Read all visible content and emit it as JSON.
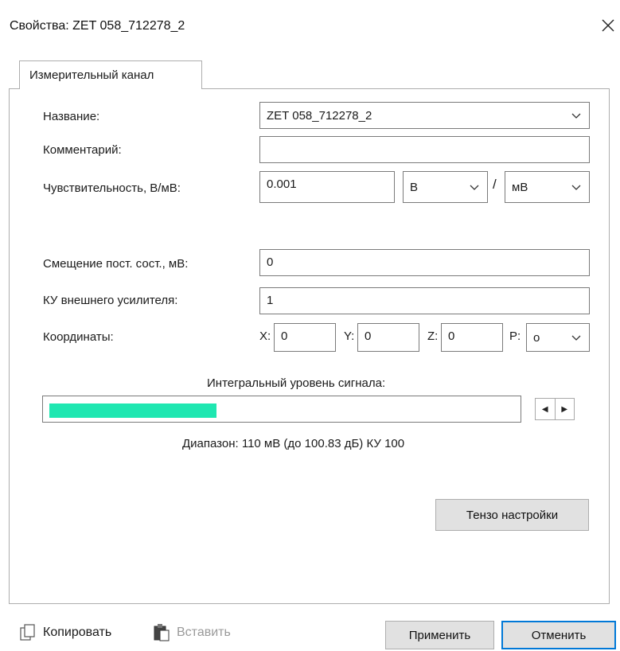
{
  "window": {
    "title": "Свойства: ZET 058_712278_2",
    "close_icon": "close-icon"
  },
  "tabs": [
    {
      "label": "Измерительный канал",
      "active": true
    }
  ],
  "form": {
    "name": {
      "label": "Название:",
      "value": "ZET 058_712278_2"
    },
    "comment": {
      "label": "Комментарий:",
      "value": ""
    },
    "sensitivity": {
      "label": "Чувствительность, В/мВ:",
      "value": "0.001",
      "unit_numerator": "В",
      "separator": "/",
      "unit_denominator": "мВ"
    },
    "offset": {
      "label": "Смещение пост. сост., мВ:",
      "value": "0"
    },
    "gain": {
      "label": "КУ внешнего усилителя:",
      "value": "1"
    },
    "coords": {
      "label": "Координаты:",
      "x_label": "X:",
      "x": "0",
      "y_label": "Y:",
      "y": "0",
      "z_label": "Z:",
      "z": "0",
      "p_label": "P:",
      "p": "o"
    }
  },
  "signal": {
    "label": "Интегральный уровень сигнала:",
    "level_fraction": 0.36,
    "fill_color": "#1fe7b1",
    "range_text": "Диапазон: 110 мВ (до 100.83 дБ) КУ 100"
  },
  "buttons": {
    "tenso_label": "Тензо настройки",
    "copy_label": "Копировать",
    "paste_label": "Вставить",
    "apply_label": "Применить",
    "cancel_label": "Отменить"
  },
  "colors": {
    "accent": "#0078d7",
    "border": "#7a7a7a",
    "button_bg": "#e1e1e1"
  }
}
